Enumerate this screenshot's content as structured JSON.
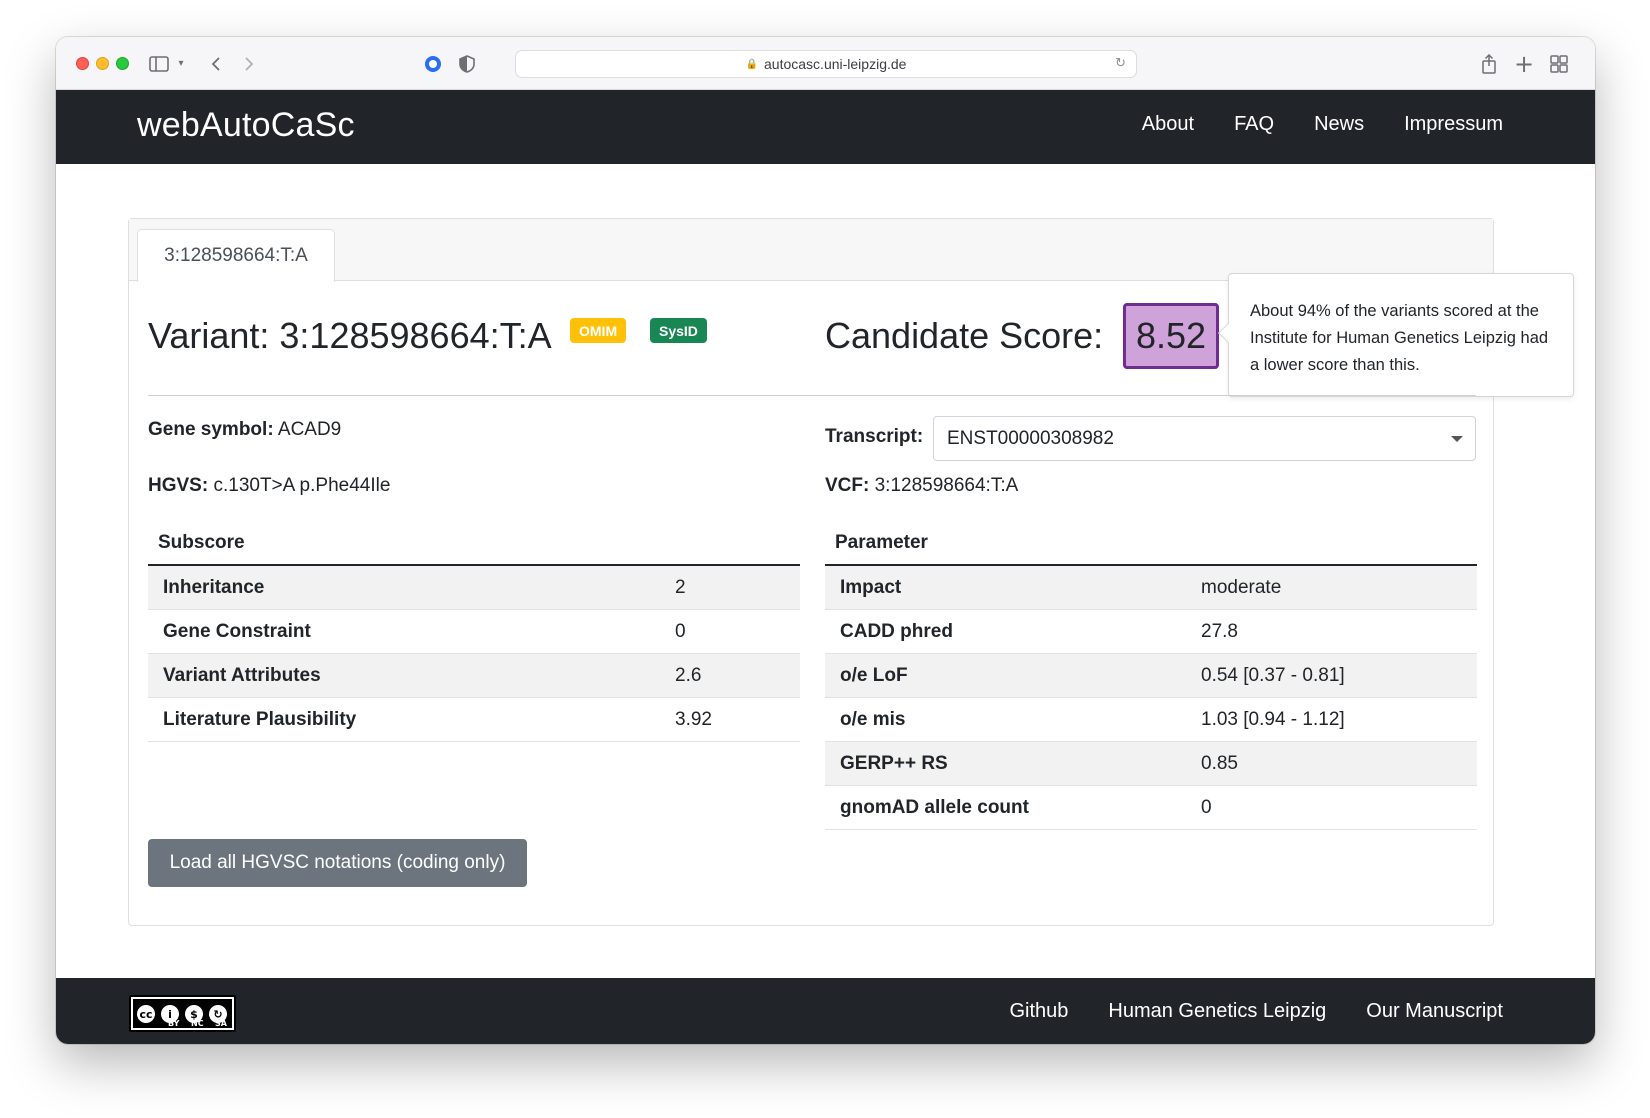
{
  "browser": {
    "url": "autocasc.uni-leipzig.de"
  },
  "navbar": {
    "brand": "webAutoCaSc",
    "links": [
      "About",
      "FAQ",
      "News",
      "Impressum"
    ]
  },
  "tab": {
    "label": "3:128598664:T:A"
  },
  "variant": {
    "title": "Variant: 3:128598664:T:A",
    "badges": [
      "OMIM",
      "SysID"
    ],
    "gene_label": "Gene symbol:",
    "gene_value": "ACAD9",
    "hgvs_label": "HGVS:",
    "hgvs_value": "c.130T>A p.Phe44Ile",
    "vcf_label": "VCF:",
    "vcf_value": "3:128598664:T:A",
    "transcript_label": "Transcript:",
    "transcript_value": "ENST00000308982"
  },
  "score": {
    "label": "Candidate Score:",
    "value": "8.52",
    "tooltip": "About 94% of the variants scored at the Institute for Human Genetics Leipzig had a lower score than this."
  },
  "subscore_table": {
    "header": "Subscore",
    "rows": [
      {
        "key": "Inheritance",
        "value": "2"
      },
      {
        "key": "Gene Constraint",
        "value": "0"
      },
      {
        "key": "Variant Attributes",
        "value": "2.6"
      },
      {
        "key": "Literature Plausibility",
        "value": "3.92"
      }
    ]
  },
  "parameter_table": {
    "header": "Parameter",
    "rows": [
      {
        "key": "Impact",
        "value": "moderate"
      },
      {
        "key": "CADD phred",
        "value": "27.8"
      },
      {
        "key": "o/e LoF",
        "value": "0.54 [0.37 - 0.81]"
      },
      {
        "key": "o/e mis",
        "value": "1.03 [0.94 - 1.12]"
      },
      {
        "key": "GERP++ RS",
        "value": "0.85"
      },
      {
        "key": "gnomAD allele count",
        "value": "0"
      }
    ]
  },
  "button": {
    "label": "Load all HGVSC notations (coding only)"
  },
  "footer": {
    "license_labels": [
      "BY",
      "NC",
      "SA"
    ],
    "links": [
      "Github",
      "Human Genetics Leipzig",
      "Our Manuscript"
    ]
  },
  "colors": {
    "navbar_bg": "#212529",
    "score_bg": "#cfa3d9",
    "score_border": "#6f2c91",
    "badge_omim": "#ffc107",
    "badge_sysid": "#198754",
    "button_bg": "#6c757d"
  }
}
